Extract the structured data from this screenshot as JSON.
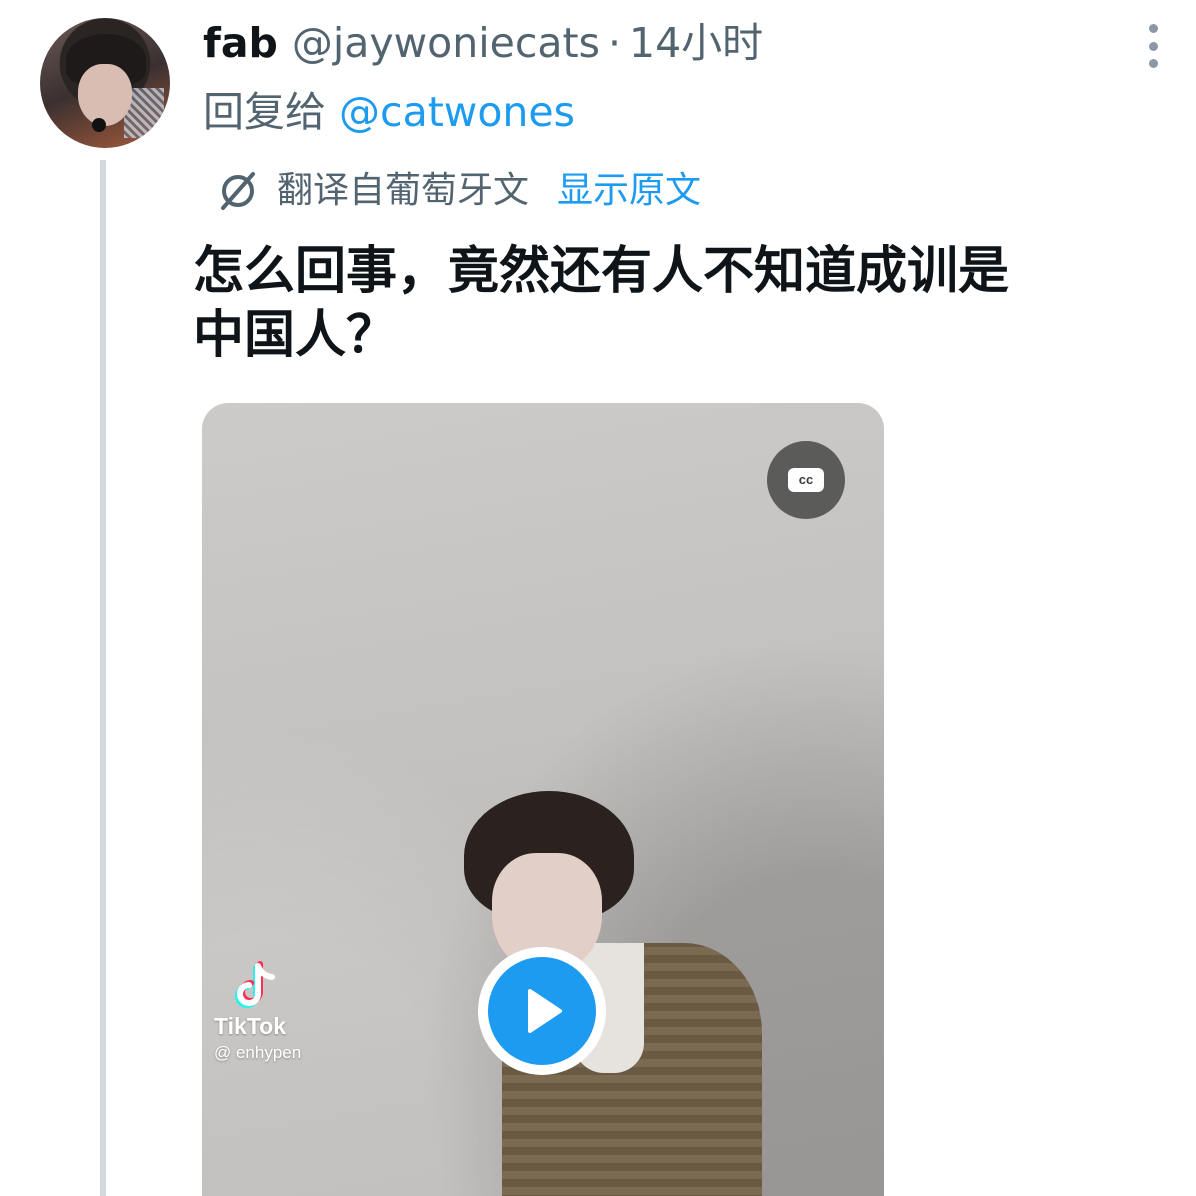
{
  "author": {
    "display_name": "fab",
    "handle": "@jaywoniecats",
    "separator": "·",
    "time": "14小时"
  },
  "reply": {
    "prefix": "回复给",
    "mention": "@catwones"
  },
  "translation": {
    "icon": "translate-icon",
    "label": "翻译自葡萄牙文",
    "show_original": "显示原文"
  },
  "tweet": {
    "lines": [
      "怎么回事，竟然还有人不知道成训是",
      "中国人？"
    ]
  },
  "media": {
    "cc_label": "cc",
    "watermark_brand": "TikTok",
    "watermark_user": "@ enhypen",
    "play_icon": "play-icon"
  },
  "colors": {
    "accent": "#1d9bf0",
    "secondary_text": "#536471",
    "primary_text": "#0f1419",
    "thread_line": "#cfd9de"
  }
}
